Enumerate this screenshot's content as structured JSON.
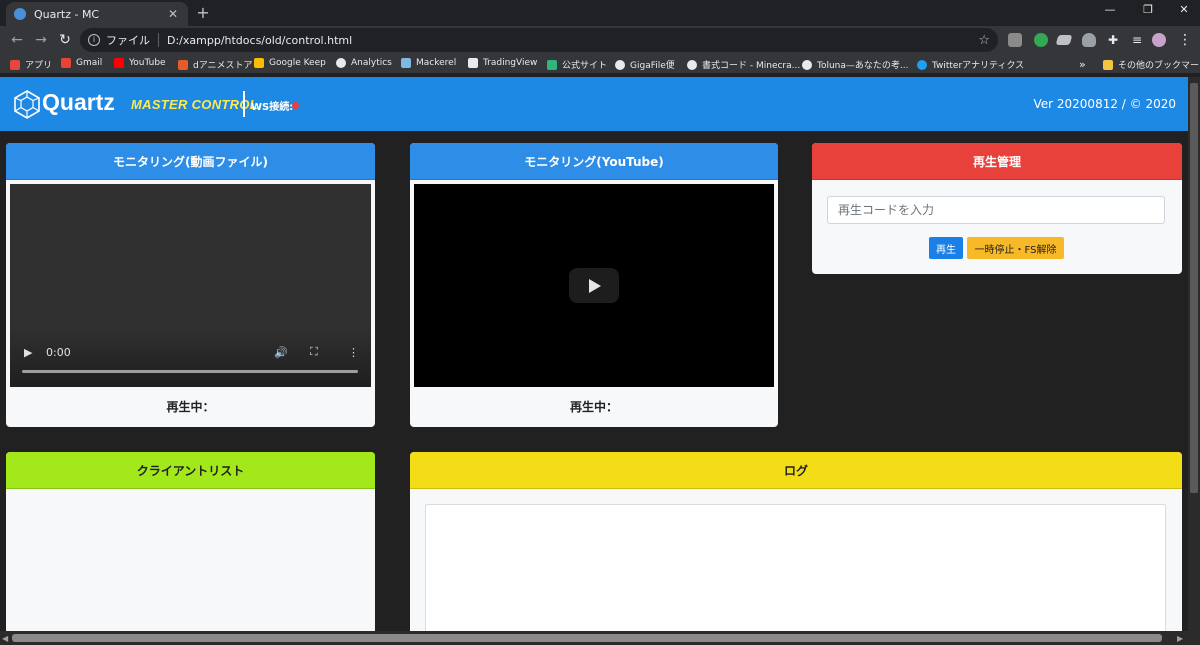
{
  "browser": {
    "tab_title": "Quartz - MC",
    "tab_close_glyph": "✕",
    "new_tab_glyph": "+",
    "window_minimize": "—",
    "window_restore": "❐",
    "window_close": "✕",
    "url_scheme_label": "ファイル",
    "url": "D:/xampp/htdocs/old/control.html",
    "bookmarks": [
      {
        "label": "アプリ",
        "icon": "apps-grid-icon",
        "color": "#e8453c"
      },
      {
        "label": "Gmail",
        "icon": "gmail-icon",
        "color": "#ea4335"
      },
      {
        "label": "YouTube",
        "icon": "youtube-icon",
        "color": "#ff0000"
      },
      {
        "label": "dアニメストア",
        "icon": "danime-icon",
        "color": "#e85a2a"
      },
      {
        "label": "Google Keep",
        "icon": "keep-icon",
        "color": "#fbbc04"
      },
      {
        "label": "Analytics",
        "icon": "globe-icon",
        "color": "#e8eaed"
      },
      {
        "label": "Mackerel",
        "icon": "mackerel-icon",
        "color": "#7fb8e0"
      },
      {
        "label": "TradingView",
        "icon": "tradingview-icon",
        "color": "#e8eaed"
      },
      {
        "label": "公式サイト",
        "icon": "hex-icon",
        "color": "#2eb67d"
      },
      {
        "label": "GigaFile便",
        "icon": "gigafile-icon",
        "color": "#e8eaed"
      },
      {
        "label": "書式コード - Minecra...",
        "icon": "globe-icon",
        "color": "#e8eaed"
      },
      {
        "label": "Toluna—あなたの考...",
        "icon": "globe-icon",
        "color": "#e8eaed"
      },
      {
        "label": "Twitterアナリティクス",
        "icon": "twitter-icon",
        "color": "#1da1f2"
      }
    ],
    "bookmarks_overflow": "»",
    "other_bookmarks": "その他のブックマーク"
  },
  "header": {
    "logo": "Quartz",
    "subtitle": "MASTER CONTROL",
    "ws_label": "WS接続:",
    "ws_status_color": "#e8413c",
    "version": "Ver 20200812 / © 2020"
  },
  "panels": {
    "video_file": {
      "title": "モニタリング(動画ファイル)",
      "header_color": "#2e8de6",
      "time": "0:00",
      "now_playing": "再生中："
    },
    "youtube": {
      "title": "モニタリング(YouTube)",
      "header_color": "#2e8de6",
      "now_playing": "再生中："
    },
    "playback": {
      "title": "再生管理",
      "header_color": "#e8413c",
      "input_placeholder": "再生コードを入力",
      "play_button": "再生",
      "pause_button": "一時停止・FS解除"
    },
    "clients": {
      "title": "クライアントリスト",
      "header_color": "#a3e81b"
    },
    "log": {
      "title": "ログ",
      "header_color": "#f2dd16"
    }
  }
}
